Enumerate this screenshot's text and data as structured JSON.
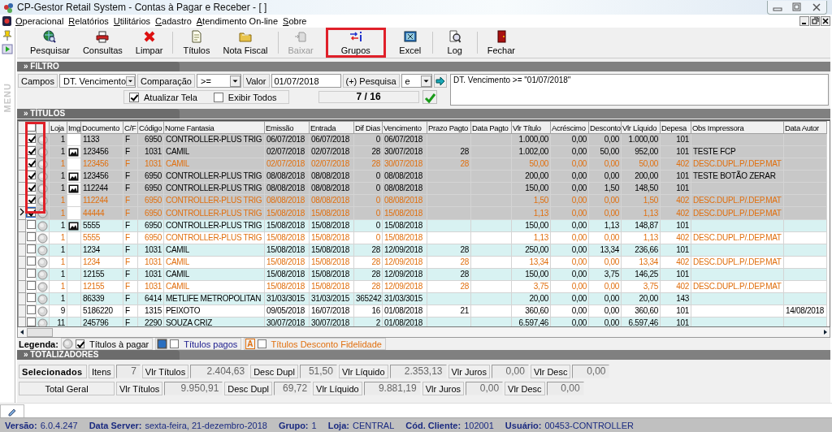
{
  "window": {
    "title": "CP-Gestor Retail System - Contas à Pagar e Receber - [ ]"
  },
  "menu": [
    "Operacional",
    "Relatórios",
    "Utilitários",
    "Cadastro",
    "Atendimento On-line",
    "Sobre"
  ],
  "side_panel": {
    "label": "MENU"
  },
  "toolbar": [
    {
      "label": "Pesquisar",
      "kind": "search",
      "disabled": false,
      "highlighted": false,
      "separator_before": false
    },
    {
      "label": "Consultas",
      "kind": "query",
      "disabled": false,
      "highlighted": false,
      "separator_before": false
    },
    {
      "label": "Limpar",
      "kind": "clear",
      "disabled": false,
      "highlighted": false,
      "separator_before": false
    },
    {
      "label": "Títulos",
      "kind": "titles",
      "disabled": false,
      "highlighted": false,
      "separator_before": true
    },
    {
      "label": "Nota Fiscal",
      "kind": "invoice",
      "disabled": false,
      "highlighted": false,
      "separator_before": false
    },
    {
      "label": "Baixar",
      "kind": "settle",
      "disabled": true,
      "highlighted": false,
      "separator_before": true
    },
    {
      "label": "Grupos",
      "kind": "groups",
      "disabled": false,
      "highlighted": true,
      "separator_before": false
    },
    {
      "label": "Excel",
      "kind": "excel",
      "disabled": false,
      "highlighted": false,
      "separator_before": false
    },
    {
      "label": "Log",
      "kind": "log",
      "disabled": false,
      "highlighted": false,
      "separator_before": true
    },
    {
      "label": "Fechar",
      "kind": "close",
      "disabled": false,
      "highlighted": false,
      "separator_before": true
    }
  ],
  "filter": {
    "title": "» FILTRO",
    "field_label": "Campos",
    "field": "DT. Vencimento",
    "comparison_label": "Comparação",
    "comparison": ">=",
    "value_label": "Valor",
    "value": "01/07/2018",
    "join_label": "(+) Pesquisa",
    "join": "e",
    "options": [
      {
        "label": "Atualizar Tela",
        "checked": true
      },
      {
        "label": "Exibir Todos",
        "checked": false
      }
    ],
    "counter": "7 / 16",
    "expression": "DT. Vencimento >= \"01/07/2018\""
  },
  "table": {
    "title": "» TÍTULOS",
    "select_all_checked": false,
    "checkbox_column_highlighted": true,
    "columns": [
      {
        "label": "Loja",
        "kind": "number"
      },
      {
        "label": "Img",
        "kind": "image"
      },
      {
        "label": "Documento",
        "kind": "text"
      },
      {
        "label": "C/F",
        "kind": "text"
      },
      {
        "label": "Código",
        "kind": "number"
      },
      {
        "label": "Nome Fantasia",
        "kind": "text"
      },
      {
        "label": "Emissão",
        "kind": "text"
      },
      {
        "label": "Entrada",
        "kind": "text"
      },
      {
        "label": "Dif Dias",
        "kind": "number"
      },
      {
        "label": "Vencimento",
        "kind": "text"
      },
      {
        "label": "Prazo Pagto",
        "kind": "number"
      },
      {
        "label": "Data Pagto",
        "kind": "text"
      },
      {
        "label": "Vlr Título",
        "kind": "number"
      },
      {
        "label": "Acréscimo",
        "kind": "number"
      },
      {
        "label": "Desconto",
        "kind": "number"
      },
      {
        "label": "Vlr Líquido",
        "kind": "number"
      },
      {
        "label": "Depesa",
        "kind": "number"
      },
      {
        "label": "Obs Impressora",
        "kind": "text"
      },
      {
        "label": "Data Autor",
        "kind": "text"
      }
    ],
    "rows": [
      {
        "checked": true,
        "current": false,
        "kind": "payable",
        "has_image": false,
        "cells": [
          "1",
          null,
          "1133",
          "F",
          "6950",
          "CONTROLLER-PLUS TRIG",
          "06/07/2018",
          "06/07/2018",
          "0",
          "06/07/2018",
          null,
          null,
          "1.000,00",
          "0,00",
          "0,00",
          "1.000,00",
          "101",
          null,
          null
        ]
      },
      {
        "checked": true,
        "current": false,
        "kind": "payable",
        "has_image": true,
        "cells": [
          "1",
          null,
          "123456",
          "F",
          "1031",
          "CAMIL",
          "02/07/2018",
          "02/07/2018",
          "28",
          "30/07/2018",
          "28",
          null,
          "1.002,00",
          "0,00",
          "50,00",
          "952,00",
          "101",
          "TESTE FCP",
          null
        ]
      },
      {
        "checked": true,
        "current": false,
        "kind": "discount",
        "has_image": false,
        "cells": [
          "1",
          null,
          "123456",
          "F",
          "1031",
          "CAMIL",
          "02/07/2018",
          "02/07/2018",
          "28",
          "30/07/2018",
          "28",
          null,
          "50,00",
          "0,00",
          "0,00",
          "50,00",
          "402",
          "DESC.DUPL.P/.DEP.MAT",
          null
        ]
      },
      {
        "checked": true,
        "current": false,
        "kind": "payable",
        "has_image": true,
        "cells": [
          "1",
          null,
          "123456",
          "F",
          "6950",
          "CONTROLLER-PLUS TRIG",
          "08/08/2018",
          "08/08/2018",
          "0",
          "08/08/2018",
          null,
          null,
          "200,00",
          "0,00",
          "0,00",
          "200,00",
          "101",
          "TESTE BOTÃO ZERAR",
          null
        ]
      },
      {
        "checked": true,
        "current": false,
        "kind": "payable",
        "has_image": true,
        "cells": [
          "1",
          null,
          "112244",
          "F",
          "6950",
          "CONTROLLER-PLUS TRIG",
          "08/08/2018",
          "08/08/2018",
          "0",
          "08/08/2018",
          null,
          null,
          "150,00",
          "0,00",
          "1,50",
          "148,50",
          "101",
          null,
          null
        ]
      },
      {
        "checked": true,
        "current": false,
        "kind": "discount",
        "has_image": false,
        "cells": [
          "1",
          null,
          "112244",
          "F",
          "6950",
          "CONTROLLER-PLUS TRIG",
          "08/08/2018",
          "08/08/2018",
          "0",
          "08/08/2018",
          null,
          null,
          "1,50",
          "0,00",
          "0,00",
          "1,50",
          "402",
          "DESC.DUPL.P/.DEP.MAT",
          null
        ]
      },
      {
        "checked": true,
        "current": true,
        "kind": "discount",
        "has_image": false,
        "cells": [
          "1",
          null,
          "44444",
          "F",
          "6950",
          "CONTROLLER-PLUS TRIG",
          "15/08/2018",
          "15/08/2018",
          "0",
          "15/08/2018",
          null,
          null,
          "1,13",
          "0,00",
          "0,00",
          "1,13",
          "402",
          "DESC.DUPL.P/.DEP.MAT",
          null
        ]
      },
      {
        "checked": false,
        "current": false,
        "kind": "payable",
        "has_image": true,
        "cells": [
          "1",
          null,
          "5555",
          "F",
          "6950",
          "CONTROLLER-PLUS TRIG",
          "15/08/2018",
          "15/08/2018",
          "0",
          "15/08/2018",
          null,
          null,
          "150,00",
          "0,00",
          "1,13",
          "148,87",
          "101",
          null,
          null
        ]
      },
      {
        "checked": false,
        "current": false,
        "kind": "discount",
        "has_image": false,
        "cells": [
          "1",
          null,
          "5555",
          "F",
          "6950",
          "CONTROLLER-PLUS TRIG",
          "15/08/2018",
          "15/08/2018",
          "0",
          "15/08/2018",
          null,
          null,
          "1,13",
          "0,00",
          "0,00",
          "1,13",
          "402",
          "DESC.DUPL.P/.DEP.MAT",
          null
        ]
      },
      {
        "checked": false,
        "current": false,
        "kind": "payable",
        "has_image": false,
        "cells": [
          "1",
          null,
          "1234",
          "F",
          "1031",
          "CAMIL",
          "15/08/2018",
          "15/08/2018",
          "28",
          "12/09/2018",
          "28",
          null,
          "250,00",
          "0,00",
          "13,34",
          "236,66",
          "101",
          null,
          null
        ]
      },
      {
        "checked": false,
        "current": false,
        "kind": "discount",
        "has_image": false,
        "cells": [
          "1",
          null,
          "1234",
          "F",
          "1031",
          "CAMIL",
          "15/08/2018",
          "15/08/2018",
          "28",
          "12/09/2018",
          "28",
          null,
          "13,34",
          "0,00",
          "0,00",
          "13,34",
          "402",
          "DESC.DUPL.P/.DEP.MAT",
          null
        ]
      },
      {
        "checked": false,
        "current": false,
        "kind": "payable",
        "has_image": false,
        "cells": [
          "1",
          null,
          "12155",
          "F",
          "1031",
          "CAMIL",
          "15/08/2018",
          "15/08/2018",
          "28",
          "12/09/2018",
          "28",
          null,
          "150,00",
          "0,00",
          "3,75",
          "146,25",
          "101",
          null,
          null
        ]
      },
      {
        "checked": false,
        "current": false,
        "kind": "discount",
        "has_image": false,
        "cells": [
          "1",
          null,
          "12155",
          "F",
          "1031",
          "CAMIL",
          "15/08/2018",
          "15/08/2018",
          "28",
          "12/09/2018",
          "28",
          null,
          "3,75",
          "0,00",
          "0,00",
          "3,75",
          "402",
          "DESC.DUPL.P/.DEP.MAT",
          null
        ]
      },
      {
        "checked": false,
        "current": false,
        "kind": "payable",
        "has_image": false,
        "cells": [
          "1",
          null,
          "86339",
          "F",
          "6414",
          "METLIFE METROPOLITAN",
          "31/03/3015",
          "31/03/2015",
          "365242",
          "31/03/3015",
          null,
          null,
          "20,00",
          "0,00",
          "0,00",
          "20,00",
          "143",
          null,
          null
        ]
      },
      {
        "checked": false,
        "current": false,
        "kind": "payable",
        "has_image": false,
        "cells": [
          "9",
          null,
          "5186220",
          "F",
          "1315",
          "PEIXOTO",
          "09/05/2018",
          "16/07/2018",
          "16",
          "01/08/2018",
          "21",
          null,
          "360,60",
          "0,00",
          "0,00",
          "360,60",
          "101",
          null,
          "14/08/2018"
        ]
      },
      {
        "checked": false,
        "current": false,
        "kind": "payable",
        "has_image": false,
        "cells": [
          "11",
          null,
          "245796",
          "F",
          "2290",
          "SOUZA CRIZ",
          "30/07/2018",
          "30/07/2018",
          "2",
          "01/08/2018",
          null,
          null,
          "6.597,46",
          "0,00",
          "0,00",
          "6.597,46",
          "101",
          null,
          null
        ]
      }
    ]
  },
  "legend": {
    "label": "Legenda:",
    "items": [
      {
        "label": "Títulos à pagar",
        "kind": "open",
        "checked": true,
        "color": "#000000"
      },
      {
        "label": "Títulos pagos",
        "kind": "paid",
        "checked": false,
        "color": "#1a1a8c"
      },
      {
        "label": "Títulos Desconto Fidelidade",
        "kind": "discount",
        "marker": "A",
        "checked": false,
        "color": "#e07010"
      }
    ]
  },
  "totals": {
    "title": "» TOTALIZADORES",
    "rows": [
      {
        "label": "Selecionados",
        "kind": "selected",
        "items_label": "Itens",
        "items": "7",
        "fields": [
          {
            "label": "Vlr Títulos",
            "value": "2.404,63"
          },
          {
            "label": "Desc Dupl",
            "value": "51,50"
          },
          {
            "label": "Vlr Líquido",
            "value": "2.353,13"
          },
          {
            "label": "Vlr Juros",
            "value": "0,00"
          },
          {
            "label": "Vlr Desc",
            "value": "0,00"
          }
        ]
      },
      {
        "label": "Total Geral",
        "kind": "total",
        "fields": [
          {
            "label": "Vlr Títulos",
            "value": "9.950,91"
          },
          {
            "label": "Desc Dupl",
            "value": "69,72"
          },
          {
            "label": "Vlr Líquido",
            "value": "9.881,19"
          },
          {
            "label": "Vlr Juros",
            "value": "0,00"
          },
          {
            "label": "Vlr Desc",
            "value": "0,00"
          }
        ]
      }
    ]
  },
  "status_bar": [
    {
      "label": "Versão:",
      "value": "6.0.4.247"
    },
    {
      "label": "Data Server:",
      "value": "sexta-feira, 21-dezembro-2018"
    },
    {
      "label": "Grupo:",
      "value": "1"
    },
    {
      "label": "Loja:",
      "value": "CENTRAL"
    },
    {
      "label": "Cód. Cliente:",
      "value": "102001"
    },
    {
      "label": "Usuário:",
      "value": "00453-CONTROLLER"
    }
  ]
}
